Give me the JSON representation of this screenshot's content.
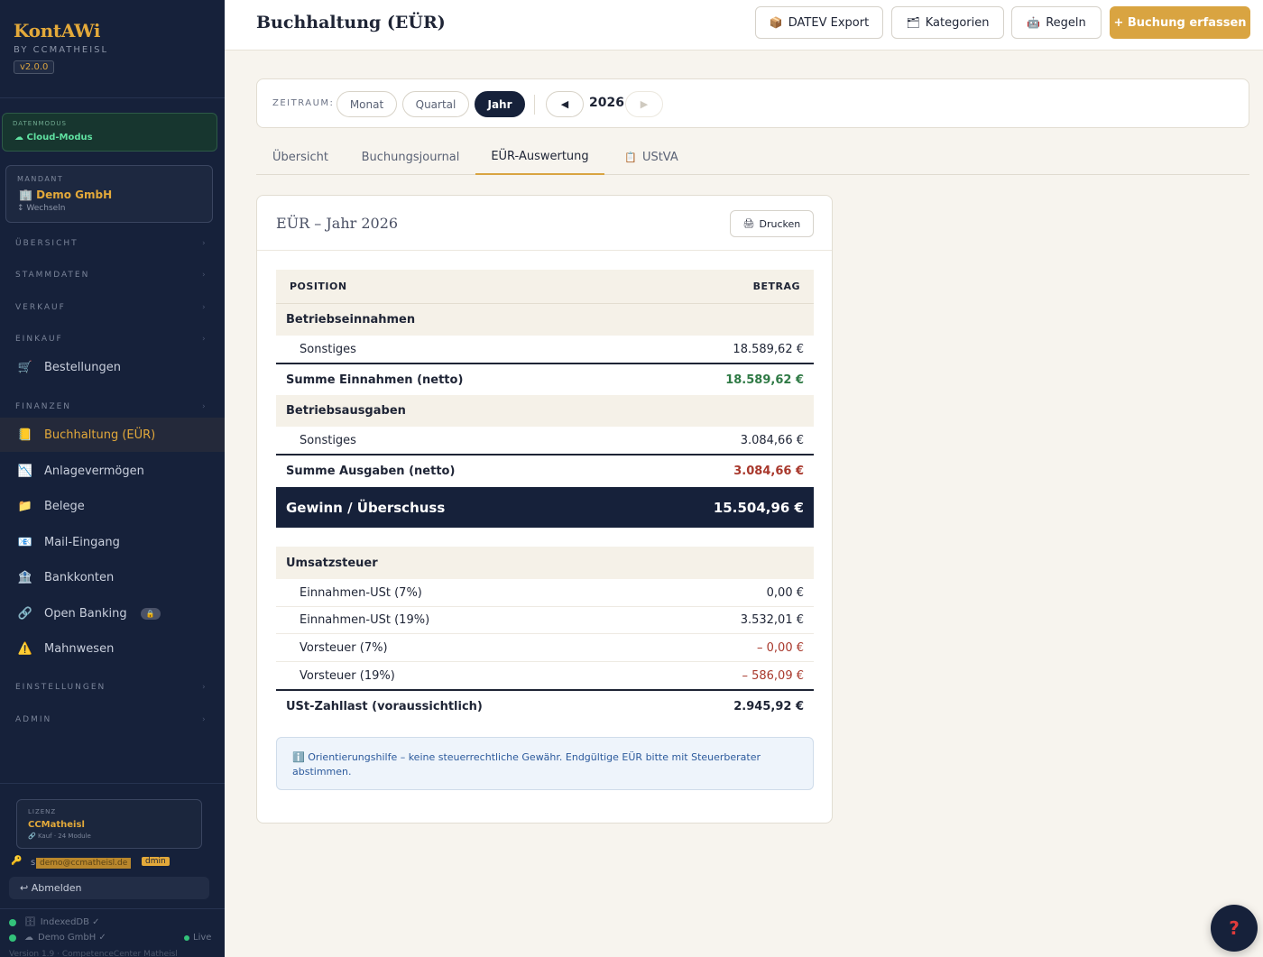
{
  "sidebar": {
    "brand": {
      "title": "KontAWi",
      "subtitle": "BY CCMATHEISL",
      "version": "v2.0.0"
    },
    "mode": {
      "label": "DATENMODUS",
      "value": "☁ Cloud-Modus"
    },
    "mandant": {
      "label": "MANDANT",
      "name": "🏢 Demo GmbH",
      "switch": "↕ Wechseln"
    },
    "sections": {
      "uebersicht": "ÜBERSICHT",
      "stammdaten": "STAMMDATEN",
      "verkauf": "VERKAUF",
      "einkauf": "EINKAUF",
      "finanzen": "FINANZEN",
      "einstellungen": "EINSTELLUNGEN",
      "admin": "ADMIN"
    },
    "items": {
      "bestellungen": "Bestellungen",
      "buchhaltung": "Buchhaltung (EÜR)",
      "anlagevermoegen": "Anlagevermögen",
      "belege": "Belege",
      "mail": "Mail-Eingang",
      "bankkonten": "Bankkonten",
      "openbanking": "Open Banking",
      "mahnwesen": "Mahnwesen"
    },
    "license": {
      "label": "LIZENZ",
      "name": "CCMatheisl",
      "info": "🔗 Kauf · 24 Module"
    },
    "user": {
      "prefix": "s",
      "email": "demo@ccmatheisl.de",
      "role": "dmin"
    },
    "logout": "↩ Abmelden",
    "status": {
      "indexeddb": "IndexedDB ✓",
      "demo": "Demo GmbH ✓",
      "live": "Live"
    },
    "version": "Version 1.9 · CompetenceCenter Matheisl"
  },
  "topbar": {
    "title": "Buchhaltung (EÜR)",
    "datev": "DATEV Export",
    "kategorien": "Kategorien",
    "regeln": "Regeln",
    "buchung": "+ Buchung erfassen"
  },
  "filter": {
    "label": "ZEITRAUM:",
    "monat": "Monat",
    "quartal": "Quartal",
    "jahr": "Jahr",
    "year": "2026"
  },
  "tabs": {
    "uebersicht": "Übersicht",
    "journal": "Buchungsjournal",
    "eur": "EÜR-Auswertung",
    "ustva": "UStVA"
  },
  "report": {
    "title": "EÜR – Jahr 2026",
    "print": "Drucken",
    "col_position": "POSITION",
    "col_betrag": "BETRAG",
    "einnahmen_group": "Betriebseinnahmen",
    "einnahmen_sonstiges": "Sonstiges",
    "einnahmen_sonstiges_val": "18.589,62 €",
    "summe_einnahmen": "Summe Einnahmen (netto)",
    "summe_einnahmen_val": "18.589,62 €",
    "ausgaben_group": "Betriebsausgaben",
    "ausgaben_sonstiges": "Sonstiges",
    "ausgaben_sonstiges_val": "3.084,66 €",
    "summe_ausgaben": "Summe Ausgaben (netto)",
    "summe_ausgaben_val": "3.084,66 €",
    "gewinn": "Gewinn / Überschuss",
    "gewinn_val": "15.504,96 €",
    "ust_group": "Umsatzsteuer",
    "ust7": "Einnahmen-USt (7%)",
    "ust7_val": "0,00 €",
    "ust19": "Einnahmen-USt (19%)",
    "ust19_val": "3.532,01 €",
    "vst7": "Vorsteuer (7%)",
    "vst7_val": "– 0,00 €",
    "vst19": "Vorsteuer (19%)",
    "vst19_val": "– 586,09 €",
    "zahllast": "USt-Zahllast (voraussichtlich)",
    "zahllast_val": "2.945,92 €",
    "notice": "ℹ️ Orientierungshilfe – keine steuerrechtliche Gewähr. Endgültige EÜR bitte mit Steuerberater abstimmen."
  },
  "help": "?",
  "colors": {
    "navy": "#16213a",
    "gold": "#d9a441",
    "green": "#2f7a45",
    "red": "#a8382c"
  }
}
